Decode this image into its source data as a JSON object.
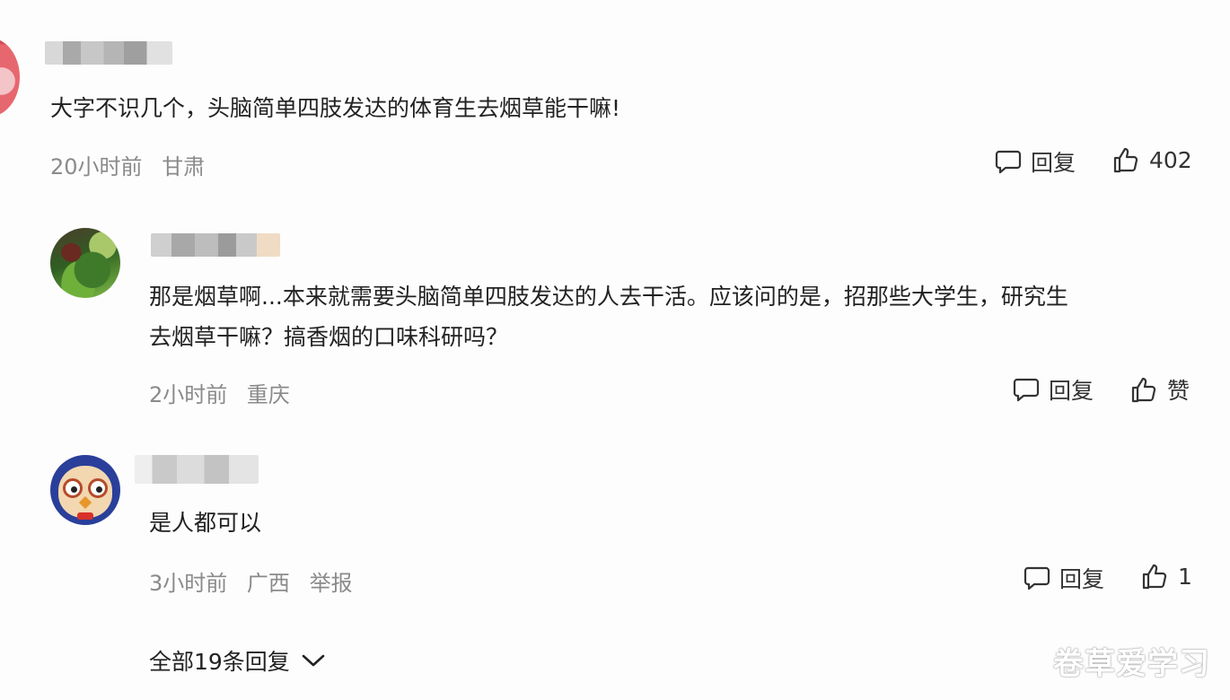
{
  "comments": [
    {
      "text": "大字不识几个，头脑简单四肢发达的体育生去烟草能干嘛!",
      "time": "20小时前",
      "location": "甘肃",
      "reply_label": "回复",
      "like_label": "402"
    },
    {
      "text_line1": "那是烟草啊...本来就需要头脑简单四肢发达的人去干活。应该问的是，招那些大学生，研究生",
      "text_line2": "去烟草干嘛？搞香烟的口味科研吗？",
      "time": "2小时前",
      "location": "重庆",
      "reply_label": "回复",
      "like_label": "赞"
    },
    {
      "text": "是人都可以",
      "time": "3小时前",
      "location": "广西",
      "report_label": "举报",
      "reply_label": "回复",
      "like_label": "1"
    }
  ],
  "expand_label": "全部19条回复",
  "watermark": "卷草爱学习",
  "icons": [
    "comment-icon",
    "thumbs-up-icon",
    "chevron-down-icon"
  ],
  "colors": {
    "text": "#222222",
    "meta": "#8a8a8a",
    "background": "#fdfdfd"
  }
}
